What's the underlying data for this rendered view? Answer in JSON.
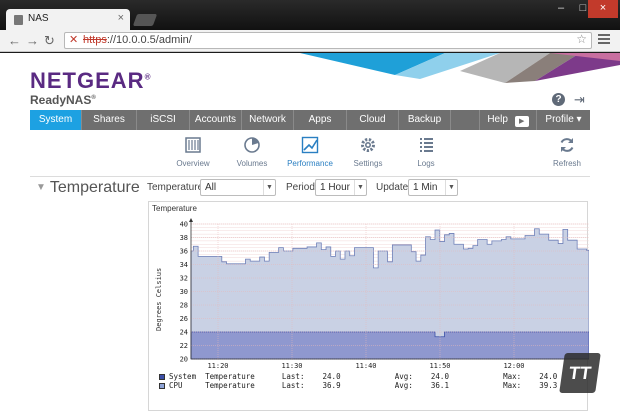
{
  "browser": {
    "tab_title": "NAS",
    "close_glyph": "×",
    "url_protocol": "https",
    "url_rest": "://10.0.0.5/admin/",
    "window_controls": [
      "–",
      "□",
      "×"
    ]
  },
  "brand": {
    "logo": "NETGEAR",
    "logo_mark": "®",
    "product": "ReadyNAS",
    "product_mark": "®",
    "accent_color": "#1da1e2",
    "logo_color": "#5a2a82"
  },
  "header_icons": {
    "help": "?",
    "logout": "logout-icon"
  },
  "mainnav": {
    "items": [
      {
        "label": "System",
        "active": true
      },
      {
        "label": "Shares"
      },
      {
        "label": "iSCSI"
      },
      {
        "label": "Accounts"
      },
      {
        "label": "Network"
      },
      {
        "label": "Apps"
      },
      {
        "label": "Cloud"
      },
      {
        "label": "Backup"
      },
      {
        "label": ""
      },
      {
        "label": "Help"
      },
      {
        "label": "Profile"
      }
    ],
    "profile_arrow": "▾"
  },
  "subnav": {
    "items": [
      {
        "label": "Overview",
        "icon": "overview-icon"
      },
      {
        "label": "Volumes",
        "icon": "volumes-icon"
      },
      {
        "label": "Performance",
        "icon": "performance-icon",
        "active": true
      },
      {
        "label": "Settings",
        "icon": "settings-icon"
      },
      {
        "label": "Logs",
        "icon": "logs-icon"
      },
      {
        "label": "Refresh",
        "icon": "refresh-icon"
      }
    ]
  },
  "section": {
    "title": "Temperature",
    "filters": {
      "temperature_label": "Temperature:",
      "temperature_value": "All",
      "period_label": "Period:",
      "period_value": "1 Hour",
      "update_label": "Update:",
      "update_value": "1 Min"
    }
  },
  "chart_data": {
    "type": "area",
    "title": "Temperature",
    "ylabel": "Degrees Celsius",
    "xlabel": "",
    "ylim": [
      20,
      40
    ],
    "yticks": [
      20,
      22,
      24,
      26,
      28,
      30,
      32,
      34,
      36,
      38,
      40
    ],
    "xticks": [
      "11:20",
      "11:30",
      "11:40",
      "11:50",
      "12:00"
    ],
    "grid": true,
    "legend_placement": "bottom",
    "series": [
      {
        "name": "System Temperature",
        "color": "#8f98cf",
        "values": [
          24,
          24,
          24,
          24,
          24,
          24,
          24,
          24,
          24,
          24,
          24,
          24,
          24,
          24,
          24,
          24,
          24,
          24,
          24,
          24,
          24,
          24,
          24,
          24,
          24,
          24,
          24,
          24,
          24,
          24,
          24,
          24,
          24,
          24,
          24,
          24,
          24,
          24,
          24,
          24,
          24,
          24,
          24,
          24,
          24,
          24,
          24,
          24,
          24,
          24,
          24,
          24,
          23.3,
          23.3,
          24,
          24,
          24,
          24,
          24,
          24,
          24,
          24,
          24,
          24,
          24,
          24,
          24,
          24,
          24,
          24,
          24,
          24,
          24,
          24,
          24,
          24,
          24,
          24,
          24,
          24,
          24,
          24,
          24,
          24,
          24
        ],
        "last": "24.0",
        "avg": "24.0",
        "max": "24.0"
      },
      {
        "name": "CPU Temperature",
        "color": "#c8d0e2",
        "values": [
          36,
          36.7,
          35.2,
          35.2,
          35.2,
          35.2,
          35.2,
          34.4,
          34.1,
          34.1,
          34.1,
          34.1,
          34.8,
          34.5,
          34.5,
          35.1,
          34.5,
          35.8,
          35.8,
          36.5,
          36,
          36,
          36.4,
          36.4,
          36.4,
          36.6,
          36.6,
          37.2,
          36.2,
          36.6,
          35.2,
          36,
          34.8,
          36,
          35.3,
          36.5,
          36.5,
          36.5,
          36.5,
          33.5,
          36,
          36,
          34.4,
          36.9,
          36.9,
          36.9,
          36.9,
          35.9,
          34.5,
          35.4,
          38.1,
          37.7,
          39.1,
          37.4,
          38.4,
          38.6,
          37,
          37,
          36.3,
          36.4,
          36.8,
          37.7,
          37.7,
          37,
          37.5,
          37.5,
          37.7,
          38.1,
          37.8,
          37.8,
          37.8,
          38.3,
          38.3,
          39.3,
          38.5,
          38.5,
          37.6,
          37.6,
          37.1,
          39.2,
          37.6,
          37.6,
          36.3,
          36.3,
          36.1
        ],
        "last": "36.9",
        "avg": "36.1",
        "max": "39.3"
      }
    ]
  },
  "legend": {
    "rows": [
      {
        "text": "System  Temperature      Last:    24.0            Avg:    24.0            Max:    24.0",
        "color": "#3c4fa8"
      },
      {
        "text": "CPU     Temperature      Last:    36.9            Avg:    36.1            Max:    39.3",
        "color": "#8ea3d6"
      }
    ]
  },
  "watermark": "TT"
}
